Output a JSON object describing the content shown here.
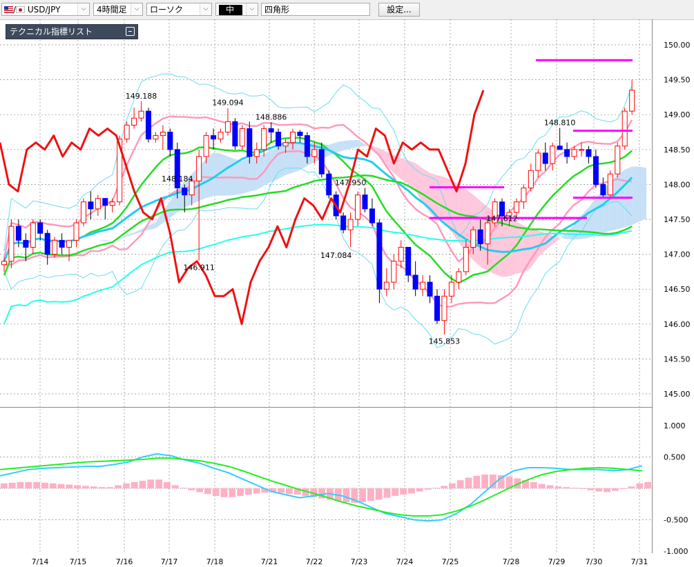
{
  "toolbar": {
    "pair": "USD/JPY",
    "timeframe": "4時間足",
    "chart_style": "ローソク",
    "line_width": "中",
    "drawing_tool": "四角形",
    "settings_label": "設定..."
  },
  "indicator_panel": {
    "title": "テクニカル指標リスト"
  },
  "colors": {
    "bull": "#ff0000",
    "bear": "#0000ff",
    "bb_mid": "#22dd22",
    "bb_1sigma": "#ff99bb",
    "bb_2sigma": "#66ddee",
    "ma_fast": "#22ccee",
    "ma_slow": "#22ffee",
    "cloud_blue": "#c6e0f8",
    "cloud_pink": "#ffc8dc",
    "rsi": "#ee1111",
    "rect": "#ff00ff",
    "macd": "#33ccff",
    "signal": "#22ee22",
    "histogram": "#ffb0c4"
  },
  "chart_data": [
    {
      "type": "candlestick",
      "symbol": "USD/JPY",
      "timeframe": "4時間足",
      "x_tick_labels": [
        "7/14",
        "7/15",
        "7/16",
        "7/17",
        "7/18",
        "7/21",
        "7/22",
        "7/23",
        "7/24",
        "7/25",
        "7/28",
        "7/29",
        "7/30",
        "7/31"
      ],
      "y_tick_labels": [
        "145.00",
        "145.50",
        "146.00",
        "146.50",
        "147.00",
        "147.50",
        "148.00",
        "148.50",
        "149.00",
        "149.50",
        "150.00"
      ],
      "ylim": [
        144.6,
        150.45
      ],
      "grid": true,
      "annotations": [
        {
          "text": "149.188",
          "value": 149.188
        },
        {
          "text": "149.094",
          "value": 149.094
        },
        {
          "text": "148.886",
          "value": 148.886
        },
        {
          "text": "148.184",
          "value": 148.184
        },
        {
          "text": "146.911",
          "value": 146.911
        },
        {
          "text": "147.950",
          "value": 147.95
        },
        {
          "text": "147.084",
          "value": 147.084
        },
        {
          "text": "145.853",
          "value": 145.853
        },
        {
          "text": "147.612",
          "value": 147.612
        },
        {
          "text": "148.810",
          "value": 148.81
        }
      ],
      "candles": [
        [
          146.85,
          146.95,
          146.75,
          146.9
        ],
        [
          146.9,
          147.5,
          146.8,
          147.4
        ],
        [
          147.4,
          147.5,
          147.1,
          147.2
        ],
        [
          147.2,
          147.3,
          146.9,
          147.1
        ],
        [
          147.1,
          147.5,
          147.0,
          147.45
        ],
        [
          147.45,
          147.5,
          147.2,
          147.3
        ],
        [
          147.3,
          147.35,
          146.85,
          147.0
        ],
        [
          147.0,
          147.25,
          146.95,
          147.2
        ],
        [
          147.2,
          147.3,
          147.0,
          147.1
        ],
        [
          147.1,
          147.2,
          146.9,
          147.2
        ],
        [
          147.2,
          147.5,
          147.1,
          147.45
        ],
        [
          147.45,
          147.8,
          147.4,
          147.75
        ],
        [
          147.75,
          147.9,
          147.5,
          147.65
        ],
        [
          147.65,
          147.85,
          147.55,
          147.8
        ],
        [
          147.8,
          147.8,
          147.5,
          147.7
        ],
        [
          147.7,
          147.8,
          147.6,
          147.75
        ],
        [
          147.75,
          148.7,
          147.7,
          148.65
        ],
        [
          148.65,
          148.9,
          148.6,
          148.85
        ],
        [
          148.85,
          149.1,
          148.8,
          148.95
        ],
        [
          148.95,
          149.19,
          148.9,
          149.05
        ],
        [
          149.05,
          149.1,
          148.6,
          148.65
        ],
        [
          148.65,
          148.75,
          148.6,
          148.7
        ],
        [
          148.7,
          148.85,
          148.5,
          148.75
        ],
        [
          148.75,
          148.8,
          148.4,
          148.5
        ],
        [
          148.5,
          148.6,
          147.8,
          147.95
        ],
        [
          147.95,
          148.0,
          147.6,
          147.85
        ],
        [
          147.85,
          148.1,
          147.7,
          148.05
        ],
        [
          148.05,
          148.5,
          146.91,
          148.4
        ],
        [
          148.4,
          148.75,
          148.3,
          148.7
        ],
        [
          148.7,
          148.8,
          148.5,
          148.65
        ],
        [
          148.65,
          148.8,
          148.6,
          148.75
        ],
        [
          148.75,
          149.09,
          148.7,
          148.9
        ],
        [
          148.9,
          148.95,
          148.5,
          148.55
        ],
        [
          148.55,
          148.85,
          148.5,
          148.8
        ],
        [
          148.8,
          148.9,
          148.3,
          148.4
        ],
        [
          148.4,
          148.6,
          148.3,
          148.5
        ],
        [
          148.5,
          148.85,
          148.4,
          148.8
        ],
        [
          148.8,
          148.89,
          148.6,
          148.75
        ],
        [
          148.75,
          148.8,
          148.5,
          148.55
        ],
        [
          148.55,
          148.65,
          148.45,
          148.6
        ],
        [
          148.6,
          148.8,
          148.5,
          148.75
        ],
        [
          148.75,
          148.78,
          148.6,
          148.7
        ],
        [
          148.7,
          148.75,
          148.3,
          148.4
        ],
        [
          148.4,
          148.6,
          148.3,
          148.5
        ],
        [
          148.5,
          148.6,
          148.1,
          148.15
        ],
        [
          148.15,
          148.2,
          147.8,
          147.85
        ],
        [
          147.85,
          147.9,
          147.5,
          147.55
        ],
        [
          147.55,
          147.6,
          147.3,
          147.35
        ],
        [
          147.35,
          147.6,
          147.1,
          147.5
        ],
        [
          147.5,
          147.9,
          147.4,
          147.85
        ],
        [
          147.85,
          147.95,
          147.6,
          147.65
        ],
        [
          147.65,
          147.8,
          147.4,
          147.45
        ],
        [
          147.45,
          147.5,
          146.3,
          146.5
        ],
        [
          146.5,
          146.8,
          146.4,
          146.6
        ],
        [
          146.6,
          147.0,
          146.5,
          146.9
        ],
        [
          146.9,
          147.2,
          146.8,
          147.1
        ],
        [
          147.1,
          147.1,
          146.6,
          146.7
        ],
        [
          146.7,
          146.9,
          146.4,
          146.5
        ],
        [
          146.5,
          146.7,
          146.4,
          146.6
        ],
        [
          146.6,
          146.7,
          146.3,
          146.4
        ],
        [
          146.4,
          146.5,
          146.0,
          146.05
        ],
        [
          146.05,
          146.5,
          145.85,
          146.4
        ],
        [
          146.4,
          146.7,
          146.3,
          146.6
        ],
        [
          146.6,
          146.8,
          146.5,
          146.75
        ],
        [
          146.75,
          147.2,
          146.7,
          147.1
        ],
        [
          147.1,
          147.4,
          147.0,
          147.35
        ],
        [
          147.35,
          147.5,
          147.05,
          147.15
        ],
        [
          147.15,
          147.5,
          146.85,
          147.45
        ],
        [
          147.45,
          147.8,
          147.4,
          147.75
        ],
        [
          147.75,
          147.8,
          147.4,
          147.55
        ],
        [
          147.55,
          147.65,
          147.4,
          147.6
        ],
        [
          147.6,
          147.8,
          147.55,
          147.75
        ],
        [
          147.75,
          148.0,
          147.65,
          147.95
        ],
        [
          147.95,
          148.3,
          147.9,
          148.2
        ],
        [
          148.2,
          148.5,
          148.1,
          148.45
        ],
        [
          148.45,
          148.6,
          148.2,
          148.3
        ],
        [
          148.3,
          148.6,
          148.2,
          148.55
        ],
        [
          148.55,
          148.81,
          148.5,
          148.5
        ],
        [
          148.5,
          148.6,
          148.3,
          148.4
        ],
        [
          148.4,
          148.55,
          148.35,
          148.5
        ],
        [
          148.5,
          148.6,
          148.4,
          148.5
        ],
        [
          148.5,
          148.55,
          148.3,
          148.4
        ],
        [
          148.4,
          148.5,
          147.95,
          148.0
        ],
        [
          148.0,
          148.1,
          147.8,
          147.85
        ],
        [
          147.85,
          148.2,
          147.8,
          148.15
        ],
        [
          148.15,
          148.6,
          148.1,
          148.55
        ],
        [
          148.55,
          149.1,
          148.5,
          149.05
        ],
        [
          149.05,
          149.5,
          149.0,
          149.35
        ]
      ],
      "rsi_line_values": [
        148.6,
        148.0,
        147.9,
        148.5,
        148.6,
        148.5,
        148.7,
        148.4,
        148.6,
        148.5,
        148.8,
        148.7,
        148.8,
        148.7,
        148.3,
        147.9,
        147.6,
        147.5,
        147.8,
        147.3,
        146.6,
        146.8,
        146.9,
        146.7,
        146.4,
        146.4,
        146.5,
        146.0,
        146.6,
        146.9,
        147.1,
        147.4,
        147.1,
        147.5,
        147.8,
        147.7,
        147.5,
        147.8,
        147.6,
        148.0,
        148.5,
        148.4,
        148.8,
        148.7,
        148.3,
        148.6,
        148.5,
        148.6,
        148.5,
        148.5,
        148.2,
        147.9,
        148.3,
        149.0,
        149.35
      ],
      "horizontal_levels": [
        {
          "value": 149.78,
          "x_from": "7/29",
          "x_to": "7/31"
        },
        {
          "value": 148.77,
          "x_from": "7/30",
          "x_to": "7/31"
        },
        {
          "value": 147.81,
          "x_from": "7/30",
          "x_to": "7/31"
        },
        {
          "value": 147.96,
          "x_from": "7/25",
          "x_to": "7/28"
        },
        {
          "value": 147.52,
          "x_from": "7/25",
          "x_to": "7/30"
        }
      ]
    },
    {
      "type": "line",
      "name": "MACD",
      "y_tick_labels": [
        "1.000",
        "0.500",
        "-0.500",
        "-1.000"
      ],
      "ylim": [
        -1.0,
        1.0
      ],
      "histogram": [
        0.08,
        0.09,
        0.1,
        0.1,
        0.1,
        0.09,
        0.08,
        0.07,
        0.06,
        0.05,
        0.04,
        0.03,
        0.02,
        0.02,
        0.05,
        0.08,
        0.1,
        0.12,
        0.14,
        0.14,
        0.1,
        0.05,
        0.01,
        -0.03,
        -0.06,
        -0.09,
        -0.12,
        -0.14,
        -0.14,
        -0.12,
        -0.1,
        -0.08,
        -0.07,
        -0.06,
        -0.07,
        -0.09,
        -0.1,
        -0.12,
        -0.14,
        -0.16,
        -0.18,
        -0.2,
        -0.22,
        -0.23,
        -0.22,
        -0.2,
        -0.18,
        -0.15,
        -0.12,
        -0.1,
        -0.08,
        -0.05,
        -0.02,
        0.01,
        0.04,
        0.08,
        0.13,
        0.17,
        0.2,
        0.22,
        0.22,
        0.21,
        0.19,
        0.16,
        0.13,
        0.1,
        0.07,
        0.05,
        0.03,
        0.02,
        0.01,
        -0.01,
        -0.03,
        -0.05,
        -0.06,
        -0.04,
        -0.01,
        0.03,
        0.08,
        0.1
      ],
      "macd": [
        0.2,
        0.25,
        0.3,
        0.32,
        0.33,
        0.34,
        0.35,
        0.35,
        0.38,
        0.42,
        0.5,
        0.55,
        0.52,
        0.45,
        0.4,
        0.32,
        0.25,
        0.15,
        0.05,
        -0.05,
        -0.1,
        -0.15,
        -0.12,
        -0.08,
        -0.12,
        -0.2,
        -0.3,
        -0.4,
        -0.45,
        -0.5,
        -0.52,
        -0.5,
        -0.4,
        -0.25,
        -0.05,
        0.15,
        0.28,
        0.33,
        0.33,
        0.32,
        0.3,
        0.3,
        0.3,
        0.28,
        0.3,
        0.36
      ],
      "signal": [
        0.3,
        0.32,
        0.34,
        0.36,
        0.38,
        0.4,
        0.42,
        0.43,
        0.44,
        0.45,
        0.46,
        0.48,
        0.48,
        0.46,
        0.44,
        0.4,
        0.35,
        0.28,
        0.2,
        0.12,
        0.05,
        -0.02,
        -0.08,
        -0.15,
        -0.22,
        -0.28,
        -0.33,
        -0.38,
        -0.42,
        -0.44,
        -0.44,
        -0.42,
        -0.36,
        -0.28,
        -0.18,
        -0.07,
        0.04,
        0.14,
        0.22,
        0.27,
        0.3,
        0.32,
        0.33,
        0.32,
        0.3,
        0.28
      ]
    }
  ]
}
